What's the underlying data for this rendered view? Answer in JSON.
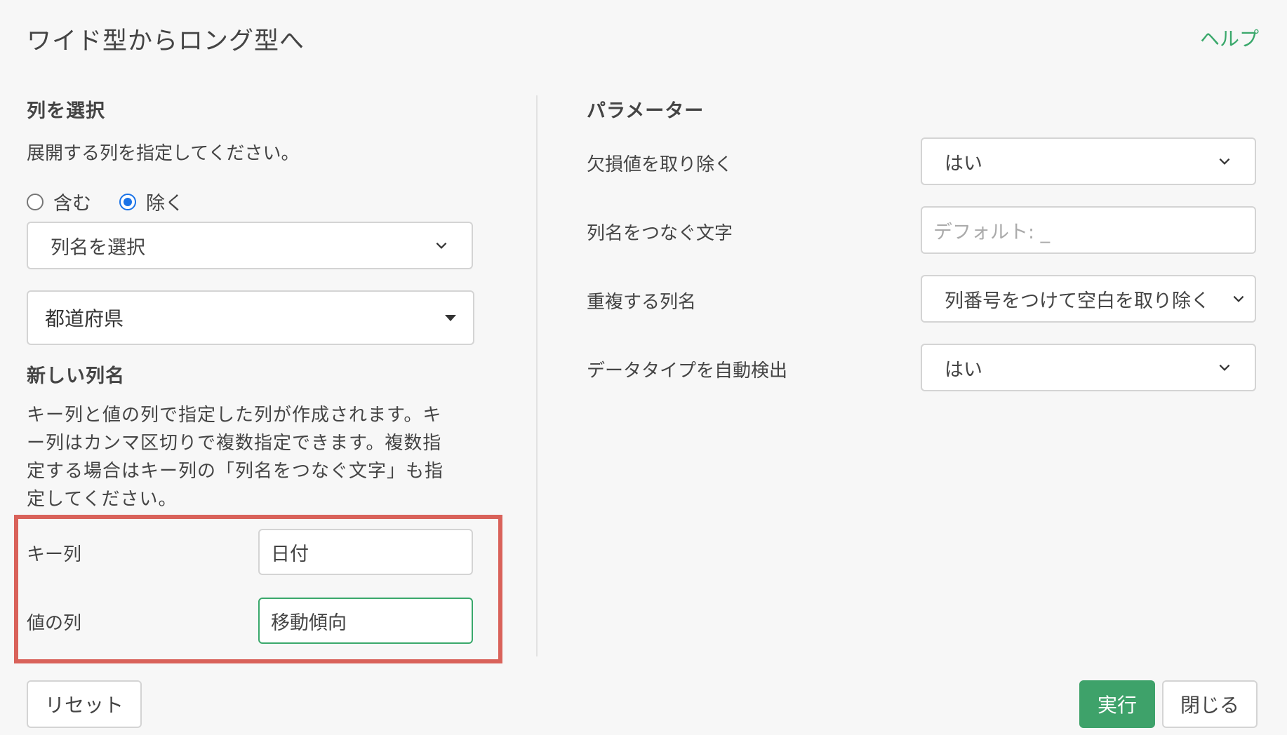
{
  "dialog": {
    "title": "ワイド型からロング型へ",
    "help_link": "ヘルプ"
  },
  "columns_section": {
    "title": "列を選択",
    "description": "展開する列を指定してください。",
    "radio_include": "含む",
    "radio_exclude": "除く",
    "selected_mode": "exclude",
    "column_select_placeholder": "列名を選択",
    "selected_column": "都道府県"
  },
  "new_column_section": {
    "title": "新しい列名",
    "description_lines": [
      "キー列と値の列で指定した列が作成されます。キ",
      "ー列はカンマ区切りで複数指定できます。複数指",
      "定する場合はキー列の「列名をつなぐ文字」も指",
      "定してください。"
    ],
    "key_label": "キー列",
    "key_value": "日付",
    "value_label": "値の列",
    "value_value": "移動傾向"
  },
  "parameters_section": {
    "title": "パラメーター",
    "remove_na_label": "欠損値を取り除く",
    "remove_na_value": "はい",
    "separator_label": "列名をつなぐ文字",
    "separator_placeholder": "デフォルト: _",
    "duplicate_label": "重複する列名",
    "duplicate_value": "列番号をつけて空白を取り除く",
    "detect_type_label": "データタイプを自動検出",
    "detect_type_value": "はい"
  },
  "footer": {
    "reset_label": "リセット",
    "run_label": "実行",
    "close_label": "閉じる"
  },
  "colors": {
    "accent_green": "#3ea26a",
    "highlight_red": "#d9625a",
    "radio_blue": "#1a73e8"
  }
}
